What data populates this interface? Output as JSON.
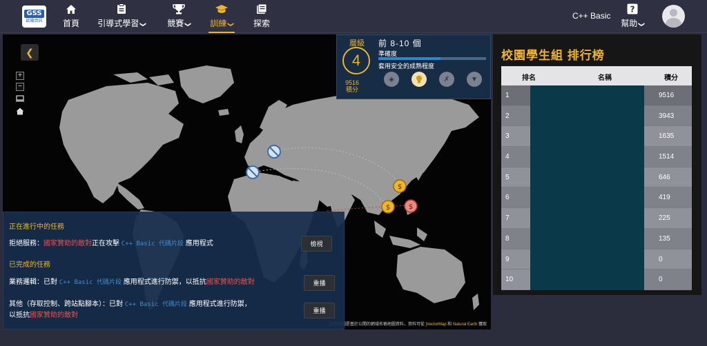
{
  "nav": {
    "logo_mark": "GSS",
    "logo_sub": "歐陽資訊",
    "items": [
      {
        "label": "首頁",
        "icon": "home-icon",
        "dropdown": false
      },
      {
        "label": "引導式學習",
        "icon": "clipboard-icon",
        "dropdown": true
      },
      {
        "label": "競賽",
        "icon": "trophy-icon",
        "dropdown": true
      },
      {
        "label": "訓練",
        "icon": "graduation-cap-icon",
        "dropdown": true,
        "active": true
      },
      {
        "label": "探索",
        "icon": "book-icon",
        "dropdown": false
      }
    ],
    "language": "C++ Basic",
    "help_label": "幫助",
    "help_icon": "question-icon"
  },
  "map": {
    "zoom_in": "+",
    "zoom_out": "−",
    "credit_prefix": "這張地圖是基於公開的網域名稱地圖資料，資料可從",
    "credit_link1": "jVectorMap",
    "credit_mid": "和",
    "credit_link2": "Natural Earth",
    "credit_suffix": "獲取"
  },
  "level": {
    "label": "層級",
    "value": "4",
    "points_value": "9516",
    "points_label": "積分",
    "title": "前 8-10 個",
    "metric_label": "準確度",
    "accuracy_fraction": 0.58,
    "description": "套用安全的成熟程度"
  },
  "missions": {
    "ongoing_heading": "正在進行中的任務",
    "ongoing": [
      {
        "prefix": "拒絕服務：",
        "enemy": "國家贊助的敵對",
        "middle": "正在攻擊",
        "code": "C++ Basic 代碼片段",
        "suffix": "應用程式",
        "button": "檢視"
      }
    ],
    "completed_heading": "已完成的任務",
    "completed": [
      {
        "prefix": "業務邏輯：已對",
        "code": "C++ Basic 代碼片段",
        "middle": "應用程式進行防禦，以抵抗",
        "enemy": "國家贊助的敵對",
        "button": "重播"
      },
      {
        "prefix": "其他（存取控制、跨站點腳本）：已對",
        "code": "C++ Basic 代碼片段",
        "middle": "應用程式進行防禦，",
        "line2_prefix": "以抵抗",
        "enemy": "國家贊助的敵對",
        "button": "重播"
      }
    ]
  },
  "leaderboard": {
    "title": "校園學生組 排行榜",
    "headers": {
      "rank": "排名",
      "name": "名稱",
      "score": "積分"
    },
    "rows": [
      {
        "rank": "1",
        "score": "9516"
      },
      {
        "rank": "2",
        "score": "3943"
      },
      {
        "rank": "3",
        "score": "1635"
      },
      {
        "rank": "4",
        "score": "1514"
      },
      {
        "rank": "5",
        "score": "646"
      },
      {
        "rank": "6",
        "score": "419"
      },
      {
        "rank": "7",
        "score": "225"
      },
      {
        "rank": "8",
        "score": "135"
      },
      {
        "rank": "9",
        "score": "0"
      },
      {
        "rank": "10",
        "score": "0"
      }
    ]
  },
  "colors": {
    "accent": "#f0b429",
    "enemy_text": "#e8514e",
    "code_text": "#3d8dd0",
    "panel_bg": "#172c45"
  }
}
